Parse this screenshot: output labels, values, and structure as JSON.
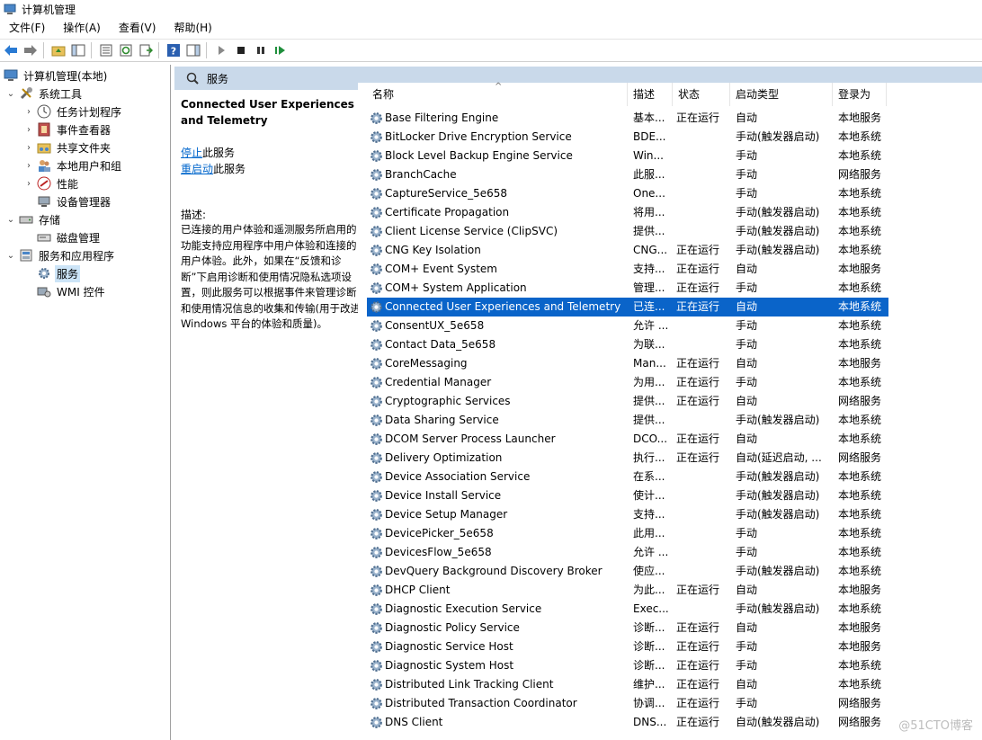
{
  "window": {
    "title": "计算机管理"
  },
  "menu": [
    "文件(F)",
    "操作(A)",
    "查看(V)",
    "帮助(H)"
  ],
  "toolbar": {
    "icons": [
      "back-arrow",
      "forward-arrow",
      "up-folder",
      "show-hide-tree",
      "properties",
      "refresh",
      "export-list",
      "help",
      "show-hide-action-pane",
      "play",
      "stop",
      "pause",
      "restart"
    ]
  },
  "tree": {
    "root": "计算机管理(本地)",
    "system_tools": "系统工具",
    "task_scheduler": "任务计划程序",
    "event_viewer": "事件查看器",
    "shared_folders": "共享文件夹",
    "local_users": "本地用户和组",
    "performance": "性能",
    "device_manager": "设备管理器",
    "storage": "存储",
    "disk_management": "磁盘管理",
    "services_apps": "服务和应用程序",
    "services": "服务",
    "wmi": "WMI 控件"
  },
  "pane": {
    "header": "服务"
  },
  "description": {
    "title": "Connected User Experiences and Telemetry",
    "stop_link": "停止",
    "stop_suffix": "此服务",
    "restart_link": "重启动",
    "restart_suffix": "此服务",
    "label": "描述:",
    "text": "已连接的用户体验和遥测服务所启用的功能支持应用程序中用户体验和连接的用户体验。此外，如果在“反馈和诊断”下启用诊断和使用情况隐私选项设置，则此服务可以根据事件来管理诊断和使用情况信息的收集和传输(用于改进 Windows 平台的体验和质量)。"
  },
  "columns": {
    "name": "名称",
    "desc": "描述",
    "status": "状态",
    "startup": "启动类型",
    "logon": "登录为"
  },
  "services": [
    {
      "name": "Base Filtering Engine",
      "desc": "基本...",
      "status": "正在运行",
      "startup": "自动",
      "logon": "本地服务"
    },
    {
      "name": "BitLocker Drive Encryption Service",
      "desc": "BDE...",
      "status": "",
      "startup": "手动(触发器启动)",
      "logon": "本地系统"
    },
    {
      "name": "Block Level Backup Engine Service",
      "desc": "Win...",
      "status": "",
      "startup": "手动",
      "logon": "本地系统"
    },
    {
      "name": "BranchCache",
      "desc": "此服...",
      "status": "",
      "startup": "手动",
      "logon": "网络服务"
    },
    {
      "name": "CaptureService_5e658",
      "desc": "One...",
      "status": "",
      "startup": "手动",
      "logon": "本地系统"
    },
    {
      "name": "Certificate Propagation",
      "desc": "将用...",
      "status": "",
      "startup": "手动(触发器启动)",
      "logon": "本地系统"
    },
    {
      "name": "Client License Service (ClipSVC)",
      "desc": "提供...",
      "status": "",
      "startup": "手动(触发器启动)",
      "logon": "本地系统"
    },
    {
      "name": "CNG Key Isolation",
      "desc": "CNG...",
      "status": "正在运行",
      "startup": "手动(触发器启动)",
      "logon": "本地系统"
    },
    {
      "name": "COM+ Event System",
      "desc": "支持...",
      "status": "正在运行",
      "startup": "自动",
      "logon": "本地服务"
    },
    {
      "name": "COM+ System Application",
      "desc": "管理...",
      "status": "正在运行",
      "startup": "手动",
      "logon": "本地系统"
    },
    {
      "name": "Connected User Experiences and Telemetry",
      "desc": "已连...",
      "status": "正在运行",
      "startup": "自动",
      "logon": "本地系统",
      "selected": true
    },
    {
      "name": "ConsentUX_5e658",
      "desc": "允许 ...",
      "status": "",
      "startup": "手动",
      "logon": "本地系统"
    },
    {
      "name": "Contact Data_5e658",
      "desc": "为联...",
      "status": "",
      "startup": "手动",
      "logon": "本地系统"
    },
    {
      "name": "CoreMessaging",
      "desc": "Man...",
      "status": "正在运行",
      "startup": "自动",
      "logon": "本地服务"
    },
    {
      "name": "Credential Manager",
      "desc": "为用...",
      "status": "正在运行",
      "startup": "手动",
      "logon": "本地系统"
    },
    {
      "name": "Cryptographic Services",
      "desc": "提供...",
      "status": "正在运行",
      "startup": "自动",
      "logon": "网络服务"
    },
    {
      "name": "Data Sharing Service",
      "desc": "提供...",
      "status": "",
      "startup": "手动(触发器启动)",
      "logon": "本地系统"
    },
    {
      "name": "DCOM Server Process Launcher",
      "desc": "DCO...",
      "status": "正在运行",
      "startup": "自动",
      "logon": "本地系统"
    },
    {
      "name": "Delivery Optimization",
      "desc": "执行...",
      "status": "正在运行",
      "startup": "自动(延迟启动, ...",
      "logon": "网络服务"
    },
    {
      "name": "Device Association Service",
      "desc": "在系...",
      "status": "",
      "startup": "手动(触发器启动)",
      "logon": "本地系统"
    },
    {
      "name": "Device Install Service",
      "desc": "使计...",
      "status": "",
      "startup": "手动(触发器启动)",
      "logon": "本地系统"
    },
    {
      "name": "Device Setup Manager",
      "desc": "支持...",
      "status": "",
      "startup": "手动(触发器启动)",
      "logon": "本地系统"
    },
    {
      "name": "DevicePicker_5e658",
      "desc": "此用...",
      "status": "",
      "startup": "手动",
      "logon": "本地系统"
    },
    {
      "name": "DevicesFlow_5e658",
      "desc": "允许 ...",
      "status": "",
      "startup": "手动",
      "logon": "本地系统"
    },
    {
      "name": "DevQuery Background Discovery Broker",
      "desc": "使应...",
      "status": "",
      "startup": "手动(触发器启动)",
      "logon": "本地系统"
    },
    {
      "name": "DHCP Client",
      "desc": "为此...",
      "status": "正在运行",
      "startup": "自动",
      "logon": "本地服务"
    },
    {
      "name": "Diagnostic Execution Service",
      "desc": "Exec...",
      "status": "",
      "startup": "手动(触发器启动)",
      "logon": "本地系统"
    },
    {
      "name": "Diagnostic Policy Service",
      "desc": "诊断...",
      "status": "正在运行",
      "startup": "自动",
      "logon": "本地服务"
    },
    {
      "name": "Diagnostic Service Host",
      "desc": "诊断...",
      "status": "正在运行",
      "startup": "手动",
      "logon": "本地服务"
    },
    {
      "name": "Diagnostic System Host",
      "desc": "诊断...",
      "status": "正在运行",
      "startup": "手动",
      "logon": "本地系统"
    },
    {
      "name": "Distributed Link Tracking Client",
      "desc": "维护...",
      "status": "正在运行",
      "startup": "自动",
      "logon": "本地系统"
    },
    {
      "name": "Distributed Transaction Coordinator",
      "desc": "协调...",
      "status": "正在运行",
      "startup": "手动",
      "logon": "网络服务"
    },
    {
      "name": "DNS Client",
      "desc": "DNS...",
      "status": "正在运行",
      "startup": "自动(触发器启动)",
      "logon": "网络服务"
    }
  ],
  "watermark": "@51CTO博客"
}
